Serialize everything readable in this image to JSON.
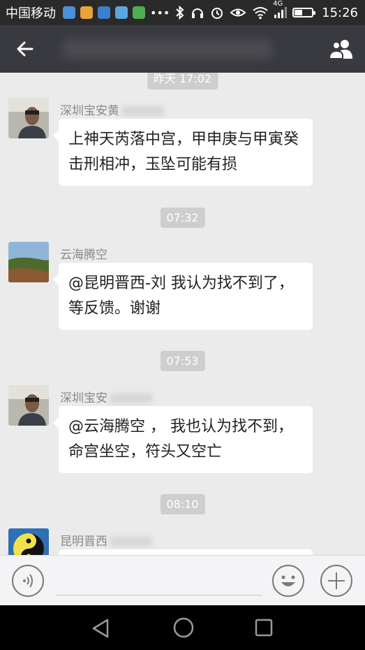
{
  "status_bar": {
    "carrier": "中国移动",
    "time": "15:26",
    "network": "4G"
  },
  "header": {
    "title": ""
  },
  "chat": {
    "top_timestamp": "昨天 17:02",
    "messages": [
      {
        "sender": "深圳宝安黄",
        "text": "上神天芮落中宫，甲申庚与甲寅癸击刑相冲，玉坠可能有损"
      },
      {
        "timestamp": "07:32",
        "sender": "云海腾空",
        "text": "@昆明晋西-刘 我认为找不到了，等反馈。谢谢"
      },
      {
        "timestamp": "07:53",
        "sender": "深圳宝安",
        "text": "@云海腾空 ， 我也认为找不到，命宫坐空，符头又空亡"
      },
      {
        "timestamp": "08:10",
        "sender": "昆明晋西"
      }
    ]
  },
  "input_bar": {
    "voice_icon": "voice-input-icon",
    "emoji_icon": "emoji-icon",
    "plus_icon": "plus-icon"
  },
  "colors": {
    "status_bg": "#2a2a2a",
    "header_bg": "#393a3f",
    "chat_bg": "#ebebeb",
    "bubble_bg": "#ffffff",
    "chip_bg": "#cecece"
  }
}
